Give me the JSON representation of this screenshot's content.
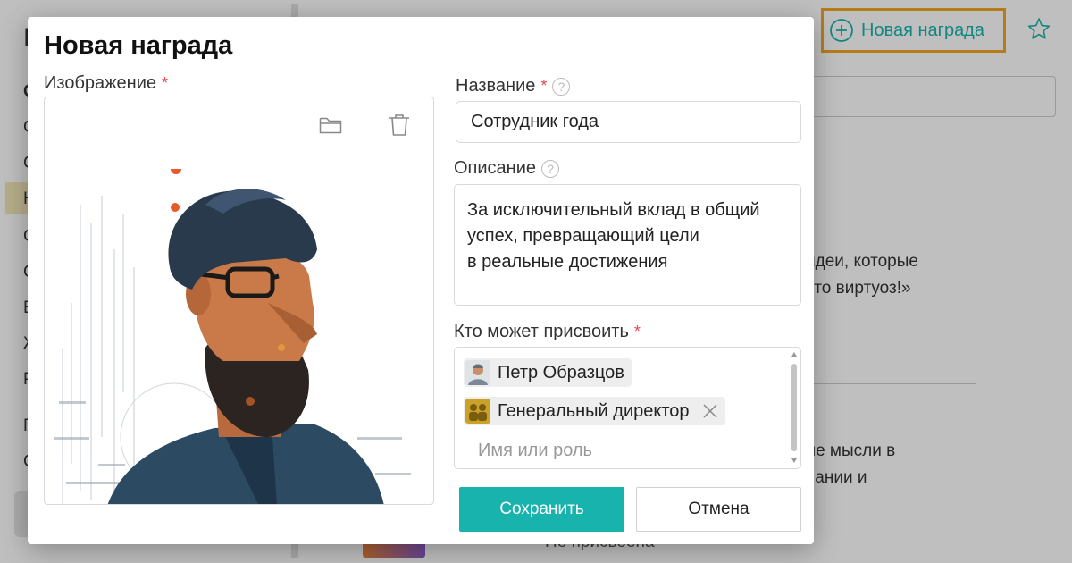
{
  "background": {
    "sidebar_letters": [
      "Н",
      "С",
      "С",
      "С",
      "Н",
      "С",
      "С",
      "В",
      "Ж",
      "Р",
      "П",
      "С"
    ],
    "header_button_label": "Новая награда",
    "header_button_icon": "plus-circle-icon",
    "favorite_icon": "star-icon",
    "snippet_1_line_1": "идеи, которые",
    "snippet_1_line_2": "это виртуоз!»",
    "snippet_2_line_1": "ле мысли в",
    "snippet_2_line_2": "пании и",
    "status_text": "Не присвоена"
  },
  "modal": {
    "title": "Новая награда",
    "image": {
      "label": "Изображение",
      "required_mark": "*",
      "folder_icon": "folder-icon",
      "trash_icon": "trash-icon"
    },
    "name": {
      "label": "Название",
      "required_mark": "*",
      "help_icon": "?",
      "value": "Сотрудник года"
    },
    "description": {
      "label": "Описание",
      "help_icon": "?",
      "lines": [
        "За исключительный вклад в общий",
        "успех, превращающий цели",
        "в реальные достижения"
      ]
    },
    "assign": {
      "label": "Кто может присвоить",
      "required_mark": "*",
      "chips": [
        {
          "label": "Петр Образцов",
          "avatar": "person-avatar"
        },
        {
          "label": "Генеральный директор",
          "avatar": "role-group-icon",
          "removable": true
        }
      ],
      "placeholder": "Имя или роль"
    },
    "save_label": "Сохранить",
    "cancel_label": "Отмена"
  },
  "colors": {
    "accent": "#19b3ad",
    "highlight_border": "#f5a623",
    "required": "#e5484d"
  }
}
